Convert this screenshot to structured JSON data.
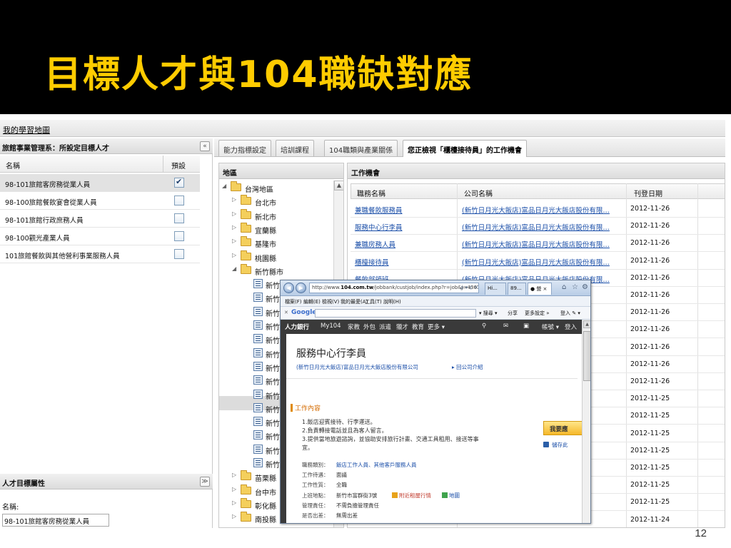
{
  "slide": {
    "title": "目標人才與104職缺對應",
    "page_number": "12"
  },
  "app": {
    "title": "我的學習地圖",
    "left_panel_header": "旅館事業管理系：所設定目標人才",
    "columns": {
      "name": "名稱",
      "default": "預設"
    },
    "targets": [
      {
        "name": "98-101旅館客房務從業人員",
        "default": true
      },
      {
        "name": "98-100旅館餐飲宴會從業人員",
        "default": false
      },
      {
        "name": "98-101旅館行政庶務人員",
        "default": false
      },
      {
        "name": "98-100觀光產業人員",
        "default": false
      },
      {
        "name": "101旅館餐飲與其他營利事業服務人員",
        "default": false
      }
    ],
    "attr_panel_header": "人才目標屬性",
    "name_label": "名稱:",
    "name_value": "98-101旅館客房務從業人員",
    "collapse_left": "«",
    "collapse_down": "≫"
  },
  "tabs": [
    {
      "label": "能力指標設定"
    },
    {
      "label": "培訓課程"
    },
    {
      "label": "104職類與產業關係"
    },
    {
      "label": "您正檢視「櫃檯接待員」的工作機會",
      "active": true
    }
  ],
  "region": {
    "header": "地區",
    "root": "台灣地區",
    "folders_top": [
      "台北市",
      "新北市",
      "宜蘭縣",
      "基隆市",
      "桃園縣"
    ],
    "expanded": "新竹縣市",
    "leaves": [
      "新竹",
      "新竹",
      "新竹",
      "新竹",
      "新竹",
      "新竹",
      "新竹",
      "新竹",
      "新竹",
      "新竹",
      "新竹",
      "新竹",
      "新竹",
      "新竹"
    ],
    "folders_bottom": [
      "苗栗縣",
      "台中市",
      "彰化縣",
      "南投縣"
    ]
  },
  "jobs": {
    "header": "工作機會",
    "columns": {
      "title": "職務名稱",
      "company": "公司名稱",
      "date": "刊登日期"
    },
    "rows": [
      {
        "title": "兼職餐飲服務員",
        "company": "(新竹日月光大飯店)富品日月光大飯店股份有限…",
        "date": "2012-11-26"
      },
      {
        "title": "服務中心行李員",
        "company": "(新竹日月光大飯店)富品日月光大飯店股份有限…",
        "date": "2012-11-26"
      },
      {
        "title": "兼職房務人員",
        "company": "(新竹日月光大飯店)富品日月光大飯店股份有限…",
        "date": "2012-11-26"
      },
      {
        "title": "櫃檯接待員",
        "company": "(新竹日月光大飯店)富品日月光大飯店股份有限…",
        "date": "2012-11-26"
      },
      {
        "title": "餐飲部領班",
        "company": "(新竹日月光大飯店)富品日月光大飯店股份有限…",
        "date": "2012-11-26"
      },
      {
        "title": "",
        "company": "份有限…",
        "date": "2012-11-26"
      },
      {
        "title": "",
        "company": "份有限…",
        "date": "2012-11-26"
      },
      {
        "title": "",
        "company": "份有限…",
        "date": "2012-11-26"
      },
      {
        "title": "",
        "company": "份有限…",
        "date": "2012-11-26"
      },
      {
        "title": "",
        "company": "",
        "date": "2012-11-26"
      },
      {
        "title": "",
        "company": "",
        "date": "2012-11-26"
      },
      {
        "title": "",
        "company": "",
        "date": "2012-11-25"
      },
      {
        "title": "",
        "company": "",
        "date": "2012-11-25"
      },
      {
        "title": "",
        "company": "",
        "date": "2012-11-25"
      },
      {
        "title": "",
        "company": "",
        "date": "2012-11-25"
      },
      {
        "title": "",
        "company": "",
        "date": "2012-11-25"
      },
      {
        "title": "",
        "company": "",
        "date": "2012-11-25"
      },
      {
        "title": "",
        "company": "",
        "date": "2012-11-25"
      },
      {
        "title": "",
        "company": "",
        "date": "2012-11-24"
      }
    ]
  },
  "browser": {
    "url_prefix": "http://www.",
    "url_domain": "104.com.tw",
    "url_rest": "/jobbank/custjob/index.php?r=job&j=43674a",
    "url_controls": "ρ ▾ ¢ ✕",
    "tabs": [
      "Hi...",
      "89...",
      "● 營 ×"
    ],
    "menu": [
      "檔案(F)",
      "編輯(E)",
      "檢視(V)",
      "我的最愛(A)",
      "工具(T)",
      "說明(H)"
    ],
    "google_label": "Google",
    "google_tools": [
      "▾ 搜尋 ▾",
      "分享",
      "更多設定 »",
      "登入 ✎ ▾"
    ],
    "site_nav": {
      "brand": "人力銀行",
      "items": [
        "My104",
        "家教",
        "外包",
        "派遣",
        "獵才",
        "教育",
        "更多 ▾"
      ],
      "right": [
        "帳號 ▾",
        "登入"
      ]
    },
    "job_title": "服務中心行李員",
    "company": "(新竹日月光大飯店)富品日月光大飯店股份有限公司",
    "company_link": "▸ 回公司介紹",
    "section": "工作內容",
    "duties": [
      "1.飯店迎賓接待、行李運送。",
      "2.負責轉接電話並且為客人留言。",
      "3.提供當地旅遊諮詢，並協助安排旅行計畫、交通工具租用、接送等事",
      "宜。"
    ],
    "apply": "我要應",
    "save": "儲存此",
    "info": [
      {
        "k": "職務類別：",
        "v": "飯店工作人員、其他客戶服務人員",
        "link": true
      },
      {
        "k": "工作待遇：",
        "v": "面議"
      },
      {
        "k": "工作性質：",
        "v": "全職"
      },
      {
        "k": "上班地點：",
        "v": "新竹市富群街3號",
        "extra1": "附近租屋行情",
        "extra2": "地圖"
      },
      {
        "k": "管理責任：",
        "v": "不需負擔管理責任"
      },
      {
        "k": "是否出差：",
        "v": "無需出差"
      }
    ]
  },
  "colors": {
    "title": "#ffcc00",
    "link": "#1a4ea8",
    "accent_orange": "#e08a00"
  }
}
